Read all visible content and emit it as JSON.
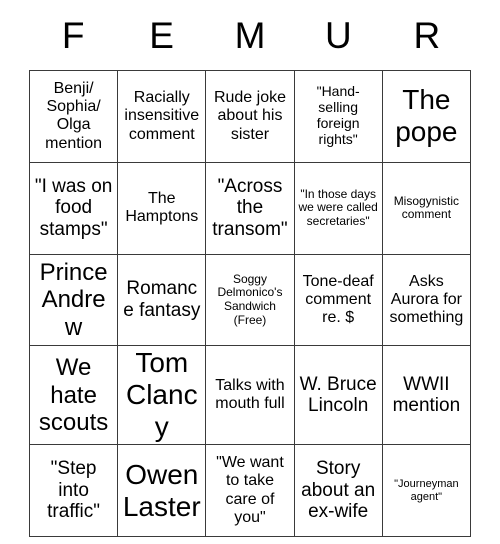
{
  "card": {
    "header_letters": [
      "F",
      "E",
      "M",
      "U",
      "R"
    ],
    "columns": 5,
    "rows": 5,
    "colors": {
      "background": "#ffffff",
      "border": "#3a3a3a",
      "text": "#000000"
    },
    "cells": [
      {
        "text": "Benji/ Sophia/ Olga mention",
        "size": "m"
      },
      {
        "text": "Racially insensitive comment",
        "size": "m"
      },
      {
        "text": "Rude joke about his sister",
        "size": "m"
      },
      {
        "text": "\"Hand-selling foreign rights\"",
        "size": "s"
      },
      {
        "text": "The pope",
        "size": "xxl"
      },
      {
        "text": "\"I was on food stamps\"",
        "size": "l"
      },
      {
        "text": "The Hamptons",
        "size": "m"
      },
      {
        "text": "\"Across the transom\"",
        "size": "l"
      },
      {
        "text": "\"In those days we were called secretaries\"",
        "size": "xs"
      },
      {
        "text": "Misogynistic comment",
        "size": "xs"
      },
      {
        "text": "Prince Andrew",
        "size": "xl"
      },
      {
        "text": "Romance fantasy",
        "size": "l"
      },
      {
        "text": "Soggy Delmonico's Sandwich (Free)",
        "size": "xs"
      },
      {
        "text": "Tone-deaf comment re. $",
        "size": "m"
      },
      {
        "text": "Asks Aurora for something",
        "size": "m"
      },
      {
        "text": "We hate scouts",
        "size": "xl"
      },
      {
        "text": "Tom Clancy",
        "size": "xxl"
      },
      {
        "text": "Talks with mouth full",
        "size": "m"
      },
      {
        "text": "W. Bruce Lincoln",
        "size": "l"
      },
      {
        "text": "WWII mention",
        "size": "l"
      },
      {
        "text": "\"Step into traffic\"",
        "size": "l"
      },
      {
        "text": "Owen Laster",
        "size": "xxl"
      },
      {
        "text": "\"We want to take care of you\"",
        "size": "m"
      },
      {
        "text": "Story about an ex-wife",
        "size": "l"
      },
      {
        "text": "\"Journeyman agent\"",
        "size": "xxs"
      }
    ]
  }
}
